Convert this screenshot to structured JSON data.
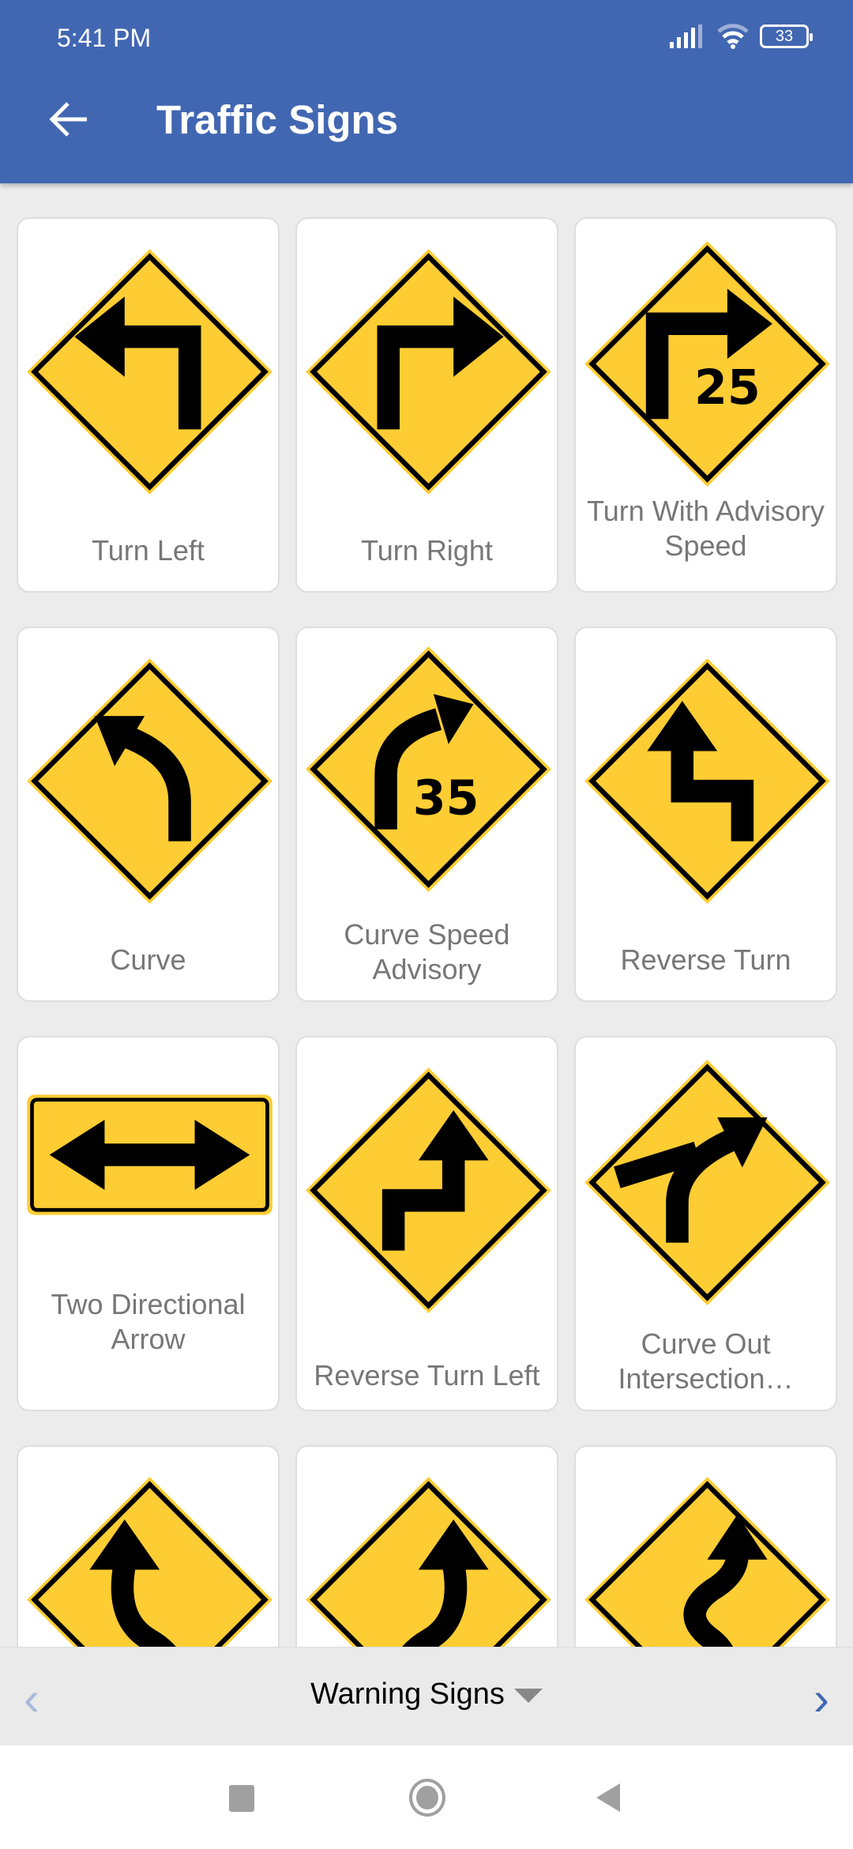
{
  "status_bar": {
    "time": "5:41 PM",
    "battery": "33"
  },
  "app_bar": {
    "title": "Traffic Signs",
    "back_icon": "arrow-left-icon"
  },
  "signs": [
    {
      "label": "Turn Left",
      "icon": "turn-left"
    },
    {
      "label": "Turn Right",
      "icon": "turn-right"
    },
    {
      "label": "Turn With Advisory Speed",
      "icon": "turn-advisory",
      "speed": "25"
    },
    {
      "label": "Curve",
      "icon": "curve-left"
    },
    {
      "label": "Curve Speed Advisory",
      "icon": "curve-advisory",
      "speed": "35"
    },
    {
      "label": "Reverse Turn",
      "icon": "reverse-turn"
    },
    {
      "label": "Two Directional Arrow",
      "icon": "two-directional"
    },
    {
      "label": "Reverse Turn Left",
      "icon": "reverse-turn-right"
    },
    {
      "label": "Curve Out Intersection…",
      "icon": "curve-out"
    },
    {
      "label": "",
      "icon": "reverse-curve-left"
    },
    {
      "label": "",
      "icon": "reverse-curve-right"
    },
    {
      "label": "",
      "icon": "winding-road"
    }
  ],
  "bottom_bar": {
    "category": "Warning Signs",
    "prev": "‹",
    "next": "›"
  },
  "colors": {
    "primary": "#4267b2",
    "sign_yellow": "#fdcd33"
  }
}
